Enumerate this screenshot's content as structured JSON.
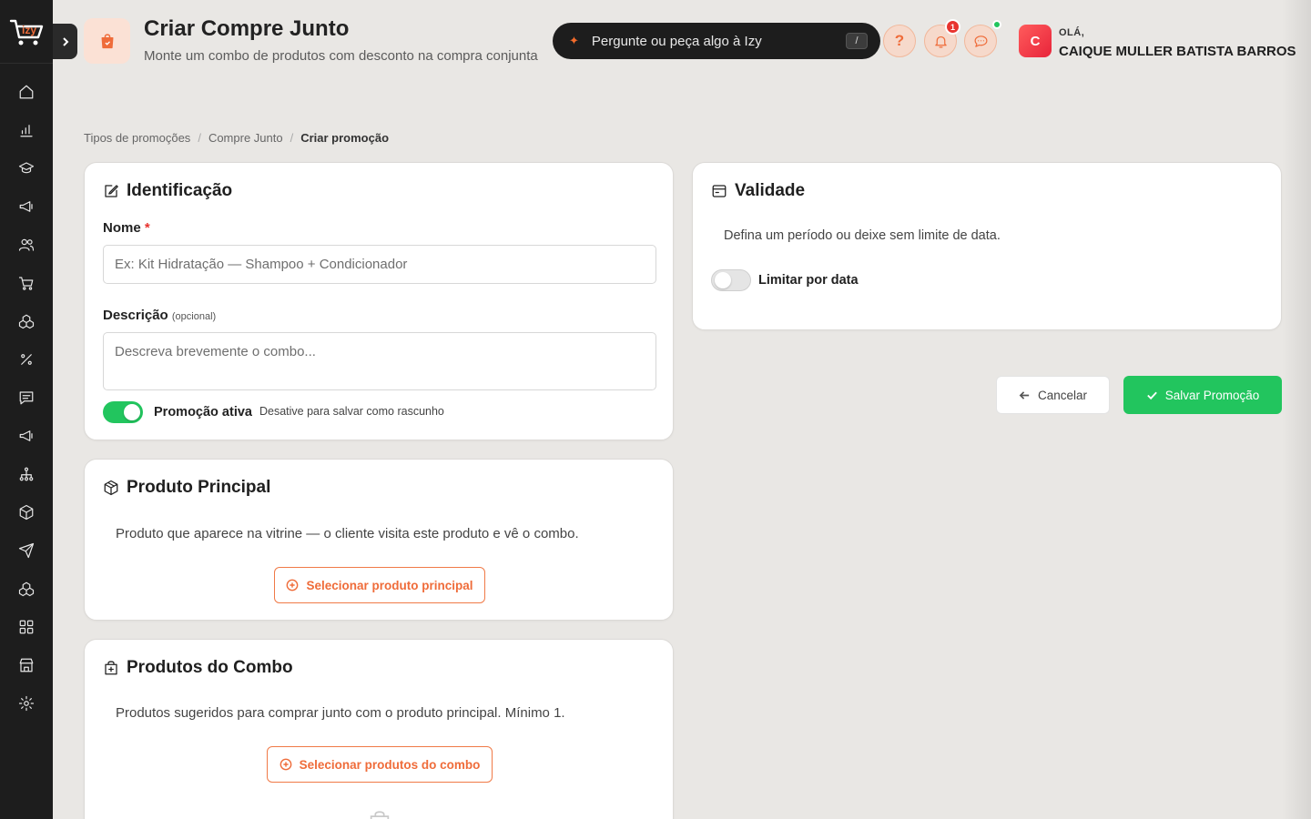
{
  "brand": {
    "logo_text": "izy",
    "accent": "#ef6c3a",
    "success": "#22c55e"
  },
  "sidebar": {
    "items": [
      {
        "icon": "home-icon"
      },
      {
        "icon": "chart-icon"
      },
      {
        "icon": "graduation-cap-icon"
      },
      {
        "icon": "megaphone-icon"
      },
      {
        "icon": "users-icon"
      },
      {
        "icon": "cart-icon"
      },
      {
        "icon": "boxes-icon"
      },
      {
        "icon": "percent-icon"
      },
      {
        "icon": "message-icon"
      },
      {
        "icon": "megaphone-icon"
      },
      {
        "icon": "network-icon"
      },
      {
        "icon": "package-icon"
      },
      {
        "icon": "send-icon"
      },
      {
        "icon": "boxes-icon"
      },
      {
        "icon": "grid-icon"
      },
      {
        "icon": "store-icon"
      },
      {
        "icon": "gear-icon"
      }
    ]
  },
  "header": {
    "title": "Criar Compre Junto",
    "subtitle": "Monte um combo de produtos com desconto na compra conjunta",
    "ai_search_placeholder": "Pergunte ou peça algo à Izy",
    "ai_search_shortcut": "/",
    "help_label": "?",
    "notification_count": "1",
    "greeting": "OLÁ,",
    "user_name": "CAIQUE MULLER BATISTA BARROS",
    "avatar_initial": "C"
  },
  "breadcrumb": {
    "items": [
      "Tipos de promoções",
      "Compre Junto",
      "Criar promoção"
    ],
    "separator": "/"
  },
  "identificacao": {
    "title": "Identificação",
    "name_label": "Nome",
    "name_required": "*",
    "name_placeholder": "Ex: Kit Hidratação — Shampoo + Condicionador",
    "description_label": "Descrição",
    "description_optional": "(opcional)",
    "description_placeholder": "Descreva brevemente o combo...",
    "active_label": "Promoção ativa",
    "active_hint": "Desative para salvar como rascunho",
    "active": true
  },
  "produto_principal": {
    "title": "Produto Principal",
    "description": "Produto que aparece na vitrine — o cliente visita este produto e vê o combo.",
    "button_label": "Selecionar produto principal"
  },
  "produtos_combo": {
    "title": "Produtos do Combo",
    "description": "Produtos sugeridos para comprar junto com o produto principal. Mínimo 1.",
    "button_label": "Selecionar produtos do combo"
  },
  "validade": {
    "title": "Validade",
    "description": "Defina um período ou deixe sem limite de data.",
    "toggle_label": "Limitar por data",
    "limit_by_date": false
  },
  "actions": {
    "cancel_label": "Cancelar",
    "save_label": "Salvar Promoção"
  }
}
